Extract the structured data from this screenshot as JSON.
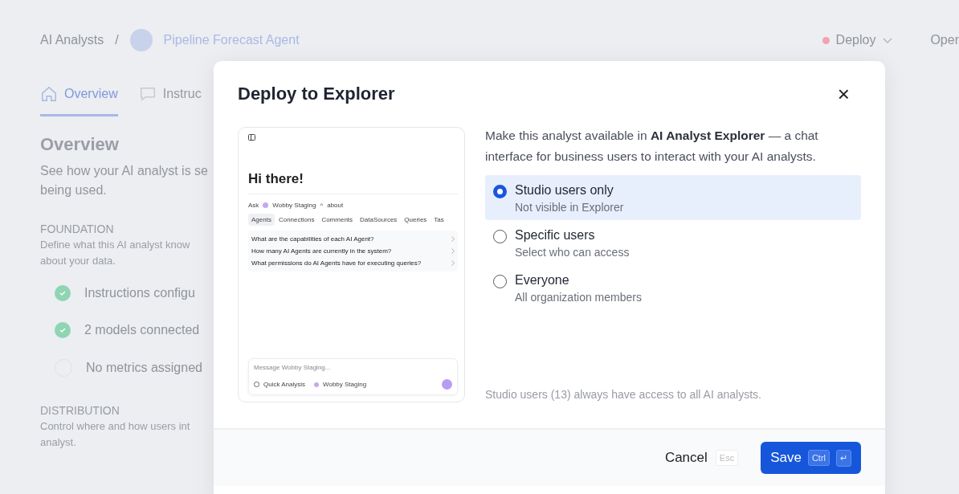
{
  "page": {
    "breadcrumb": {
      "root": "AI Analysts",
      "separator": "/",
      "current": "Pipeline Forecast Agent"
    },
    "deploy": {
      "label": "Deploy"
    },
    "open": "Oper",
    "tabs": [
      {
        "label": "Overview",
        "selected": true
      },
      {
        "label": "Instruc",
        "selected": false
      }
    ],
    "heading": "Overview",
    "description_lines": [
      "See how your AI analyst is se",
      "being used."
    ],
    "sections": [
      {
        "title": "FOUNDATION",
        "lines": [
          "Define what this AI analyst know",
          "about your data."
        ],
        "items": [
          {
            "label": "Instructions configu",
            "done": true
          },
          {
            "label": "2 models connected",
            "done": true
          },
          {
            "label": "No metrics assigned",
            "done": false
          }
        ]
      },
      {
        "title": "DISTRIBUTION",
        "lines": [
          "Control where and how users int",
          "analyst."
        ]
      }
    ]
  },
  "dialog": {
    "title": "Deploy to Explorer",
    "close": "×",
    "preview": {
      "greeting": "Hi there!",
      "ask": "Ask",
      "source": "Wobby Staging",
      "caret": "^",
      "about": "about",
      "tabs": [
        {
          "label": "Agents",
          "selected": true
        },
        {
          "label": "Connections",
          "selected": false
        },
        {
          "label": "Comments",
          "selected": false
        },
        {
          "label": "DataSources",
          "selected": false
        },
        {
          "label": "Queries",
          "selected": false
        },
        {
          "label": "Tas",
          "selected": false
        }
      ],
      "questions": [
        "What are the capabilities of each AI Agent?",
        "How many AI Agents are currently in the system?",
        "What permissions do AI Agents have for executing queries?"
      ],
      "placeholder": "Message Wobby Staging...",
      "mode": "Quick Analysis",
      "model": "Wobby Staging"
    },
    "intro": "Make this analyst available in **AI Analyst Explorer** — a chat interface for business users to interact with your AI analysts.",
    "options": [
      {
        "label": "Studio users only",
        "hint": "Not visible in Explorer",
        "selected": true
      },
      {
        "label": "Specific users",
        "hint": "Select who can access",
        "selected": false
      },
      {
        "label": "Everyone",
        "hint": "All organization members",
        "selected": false
      }
    ],
    "note": "Studio users (13) always have access to all AI analysts.",
    "cancel": {
      "label": "Cancel",
      "key": "Esc"
    },
    "save": {
      "label": "Save",
      "keys": [
        "Ctrl",
        "↵"
      ]
    }
  }
}
